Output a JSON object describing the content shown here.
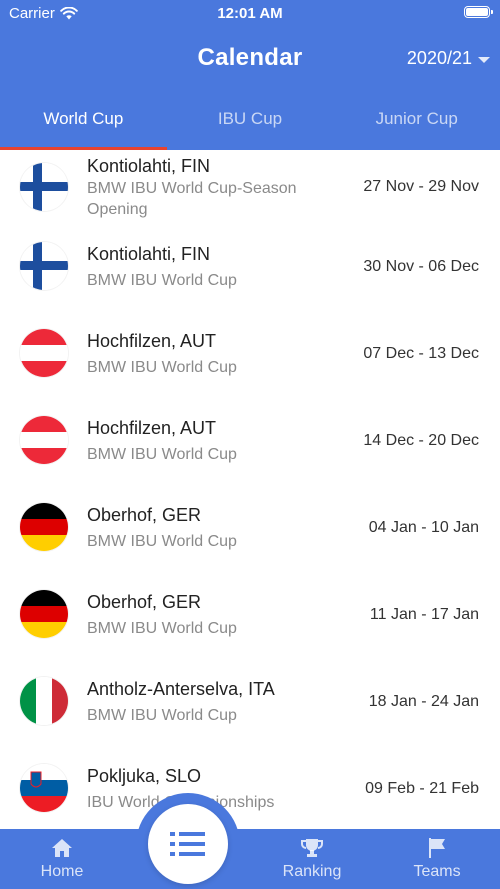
{
  "status_bar": {
    "carrier": "Carrier",
    "time": "12:01 AM",
    "wifi_icon": "wifi-icon",
    "battery_icon": "battery-icon"
  },
  "header": {
    "title": "Calendar",
    "season": "2020/21",
    "season_icon": "caret-down-icon"
  },
  "tabs": [
    {
      "label": "World Cup",
      "active": true
    },
    {
      "label": "IBU Cup",
      "active": false
    },
    {
      "label": "Junior Cup",
      "active": false
    }
  ],
  "events": [
    {
      "place": "Kontiolahti, FIN",
      "event": "BMW IBU World Cup-Season Opening",
      "dates": "27 Nov - 29 Nov",
      "flag": "FIN"
    },
    {
      "place": "Kontiolahti, FIN",
      "event": "BMW IBU World Cup",
      "dates": "30 Nov - 06 Dec",
      "flag": "FIN"
    },
    {
      "place": "Hochfilzen, AUT",
      "event": "BMW IBU World Cup",
      "dates": "07 Dec - 13 Dec",
      "flag": "AUT"
    },
    {
      "place": "Hochfilzen, AUT",
      "event": "BMW IBU World Cup",
      "dates": "14 Dec - 20 Dec",
      "flag": "AUT"
    },
    {
      "place": "Oberhof, GER",
      "event": "BMW IBU World Cup",
      "dates": "04 Jan - 10 Jan",
      "flag": "GER"
    },
    {
      "place": "Oberhof, GER",
      "event": "BMW IBU World Cup",
      "dates": "11 Jan - 17 Jan",
      "flag": "GER"
    },
    {
      "place": "Antholz-Anterselva, ITA",
      "event": "BMW IBU World Cup",
      "dates": "18 Jan - 24 Jan",
      "flag": "ITA"
    },
    {
      "place": "Pokljuka, SLO",
      "event": "IBU World Championships",
      "dates": "09 Feb - 21 Feb",
      "flag": "SLO"
    }
  ],
  "bottom_nav": {
    "items": [
      {
        "label": "Home",
        "icon": "home-icon"
      },
      {
        "label": "Ranking",
        "icon": "trophy-icon"
      },
      {
        "label": "Teams",
        "icon": "flag-icon"
      }
    ],
    "center_button_icon": "list-icon"
  },
  "colors": {
    "primary": "#4a78dd",
    "tab_indicator": "#e8432e",
    "text_dark": "#222222",
    "text_muted": "#8a8a8a"
  }
}
